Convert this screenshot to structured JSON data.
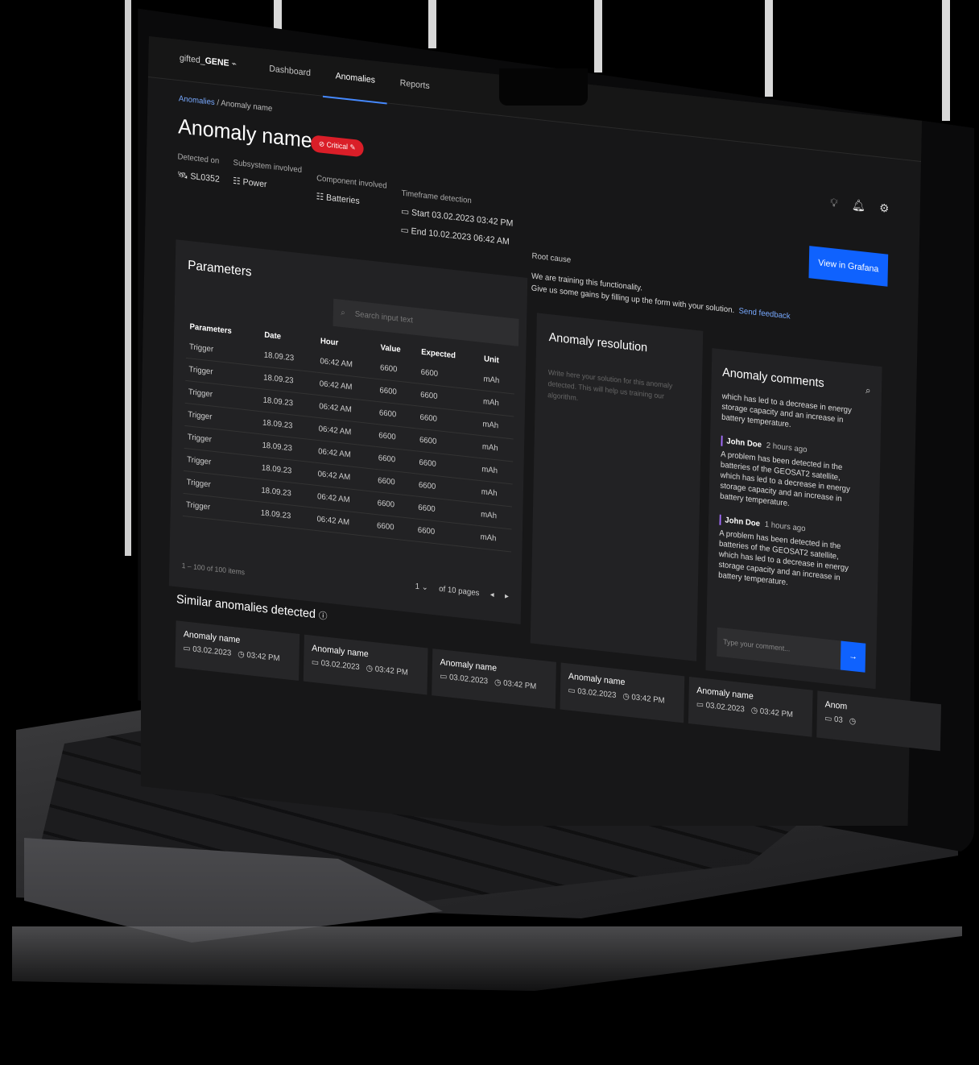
{
  "app": {
    "logo_prefix": "gifted_",
    "logo_name": "GENE"
  },
  "nav": {
    "tabs": [
      "Dashboard",
      "Anomalies",
      "Reports"
    ],
    "active": "Anomalies"
  },
  "breadcrumb": {
    "parent": "Anomalies",
    "separator": "/",
    "current": "Anomaly name"
  },
  "page": {
    "title": "Anomaly name",
    "severity": "Critical"
  },
  "meta": {
    "detected_label": "Detected on",
    "detected_value": "SL0352",
    "subsystem_label": "Subsystem involved",
    "subsystem_value": "Power",
    "component_label": "Component involved",
    "component_value": "Batteries",
    "timeframe_label": "Timeframe detection",
    "start_label": "Start",
    "start_date": "03.02.2023",
    "start_time": "03:42 PM",
    "end_label": "End",
    "end_date": "10.02.2023",
    "end_time": "06:42 AM"
  },
  "root_cause": {
    "label": "Root cause",
    "line1": "We are training this functionality.",
    "line2": "Give us some gains by filling up the form with your solution.",
    "link": "Send feedback"
  },
  "actions": {
    "grafana": "View in Grafana"
  },
  "header_icons": [
    "lightbulb-icon",
    "bell-icon",
    "gear-icon"
  ],
  "parameters": {
    "title": "Parameters",
    "search_placeholder": "Search input text",
    "columns": [
      "Parameters",
      "Date",
      "Hour",
      "Value",
      "Expected",
      "Unit"
    ],
    "rows": [
      [
        "Trigger",
        "18.09.23",
        "06:42 AM",
        "6600",
        "6600",
        "mAh"
      ],
      [
        "Trigger",
        "18.09.23",
        "06:42 AM",
        "6600",
        "6600",
        "mAh"
      ],
      [
        "Trigger",
        "18.09.23",
        "06:42 AM",
        "6600",
        "6600",
        "mAh"
      ],
      [
        "Trigger",
        "18.09.23",
        "06:42 AM",
        "6600",
        "6600",
        "mAh"
      ],
      [
        "Trigger",
        "18.09.23",
        "06:42 AM",
        "6600",
        "6600",
        "mAh"
      ],
      [
        "Trigger",
        "18.09.23",
        "06:42 AM",
        "6600",
        "6600",
        "mAh"
      ],
      [
        "Trigger",
        "18.09.23",
        "06:42 AM",
        "6600",
        "6600",
        "mAh"
      ],
      [
        "Trigger",
        "18.09.23",
        "06:42 AM",
        "6600",
        "6600",
        "mAh"
      ]
    ],
    "items_text": "1 – 100 of 100 items",
    "page": "1",
    "pages_text": "of 10 pages"
  },
  "resolution": {
    "title": "Anomaly resolution",
    "placeholder": "Write here your solution for this anomaly detected. This will help us training our algorithm."
  },
  "comments": {
    "title": "Anomaly comments",
    "partial": "which has led to a decrease in energy storage capacity and an increase in battery temperature.",
    "items": [
      {
        "author": "John Doe",
        "time": "2 hours ago",
        "text": "A problem has been detected in the batteries of the GEOSAT2 satellite, which has led to a decrease in energy storage capacity and an increase in battery temperature."
      },
      {
        "author": "John Doe",
        "time": "1 hours ago",
        "text": "A problem has been detected in the batteries of the GEOSAT2 satellite, which has led to a decrease in energy storage capacity and an increase in battery temperature."
      }
    ],
    "input_placeholder": "Type your comment..."
  },
  "similar": {
    "title": "Similar anomalies detected",
    "cards": [
      {
        "name": "Anomaly name",
        "date": "03.02.2023",
        "time": "03:42 PM"
      },
      {
        "name": "Anomaly name",
        "date": "03.02.2023",
        "time": "03:42 PM"
      },
      {
        "name": "Anomaly name",
        "date": "03.02.2023",
        "time": "03:42 PM"
      },
      {
        "name": "Anomaly name",
        "date": "03.02.2023",
        "time": "03:42 PM"
      },
      {
        "name": "Anomaly name",
        "date": "03.02.2023",
        "time": "03:42 PM"
      },
      {
        "name": "Anom",
        "date": "03",
        "time": ""
      }
    ]
  },
  "colors": {
    "accent": "#0f62fe",
    "critical": "#da1e28",
    "link": "#78a9ff",
    "surface": "#222224"
  }
}
